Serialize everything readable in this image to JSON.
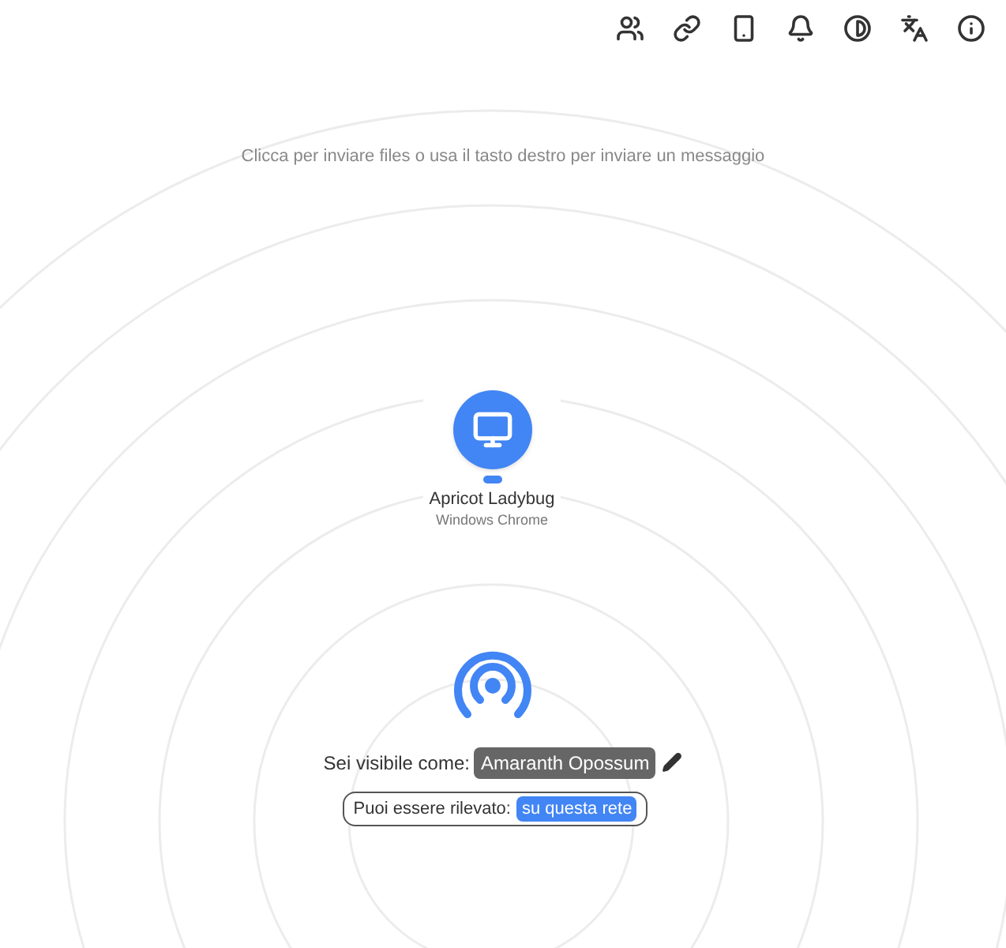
{
  "toolbar": {
    "buttons": [
      {
        "kind": "rooms"
      },
      {
        "kind": "pair"
      },
      {
        "kind": "install"
      },
      {
        "kind": "notifications"
      },
      {
        "kind": "theme"
      },
      {
        "kind": "language"
      },
      {
        "kind": "about"
      }
    ]
  },
  "instructions": "Clicca per inviare files o usa il tasto destro per inviare un messaggio",
  "peers": [
    {
      "name": "Apricot Ladybug",
      "device": "Windows Chrome",
      "kind": "desktop"
    }
  ],
  "footer": {
    "visible_as_label": "Sei visibile come:",
    "display_name": "Amaranth Opossum",
    "discoverable_label": "Puoi essere rilevato:",
    "discoverable_scope": "su questa rete"
  }
}
